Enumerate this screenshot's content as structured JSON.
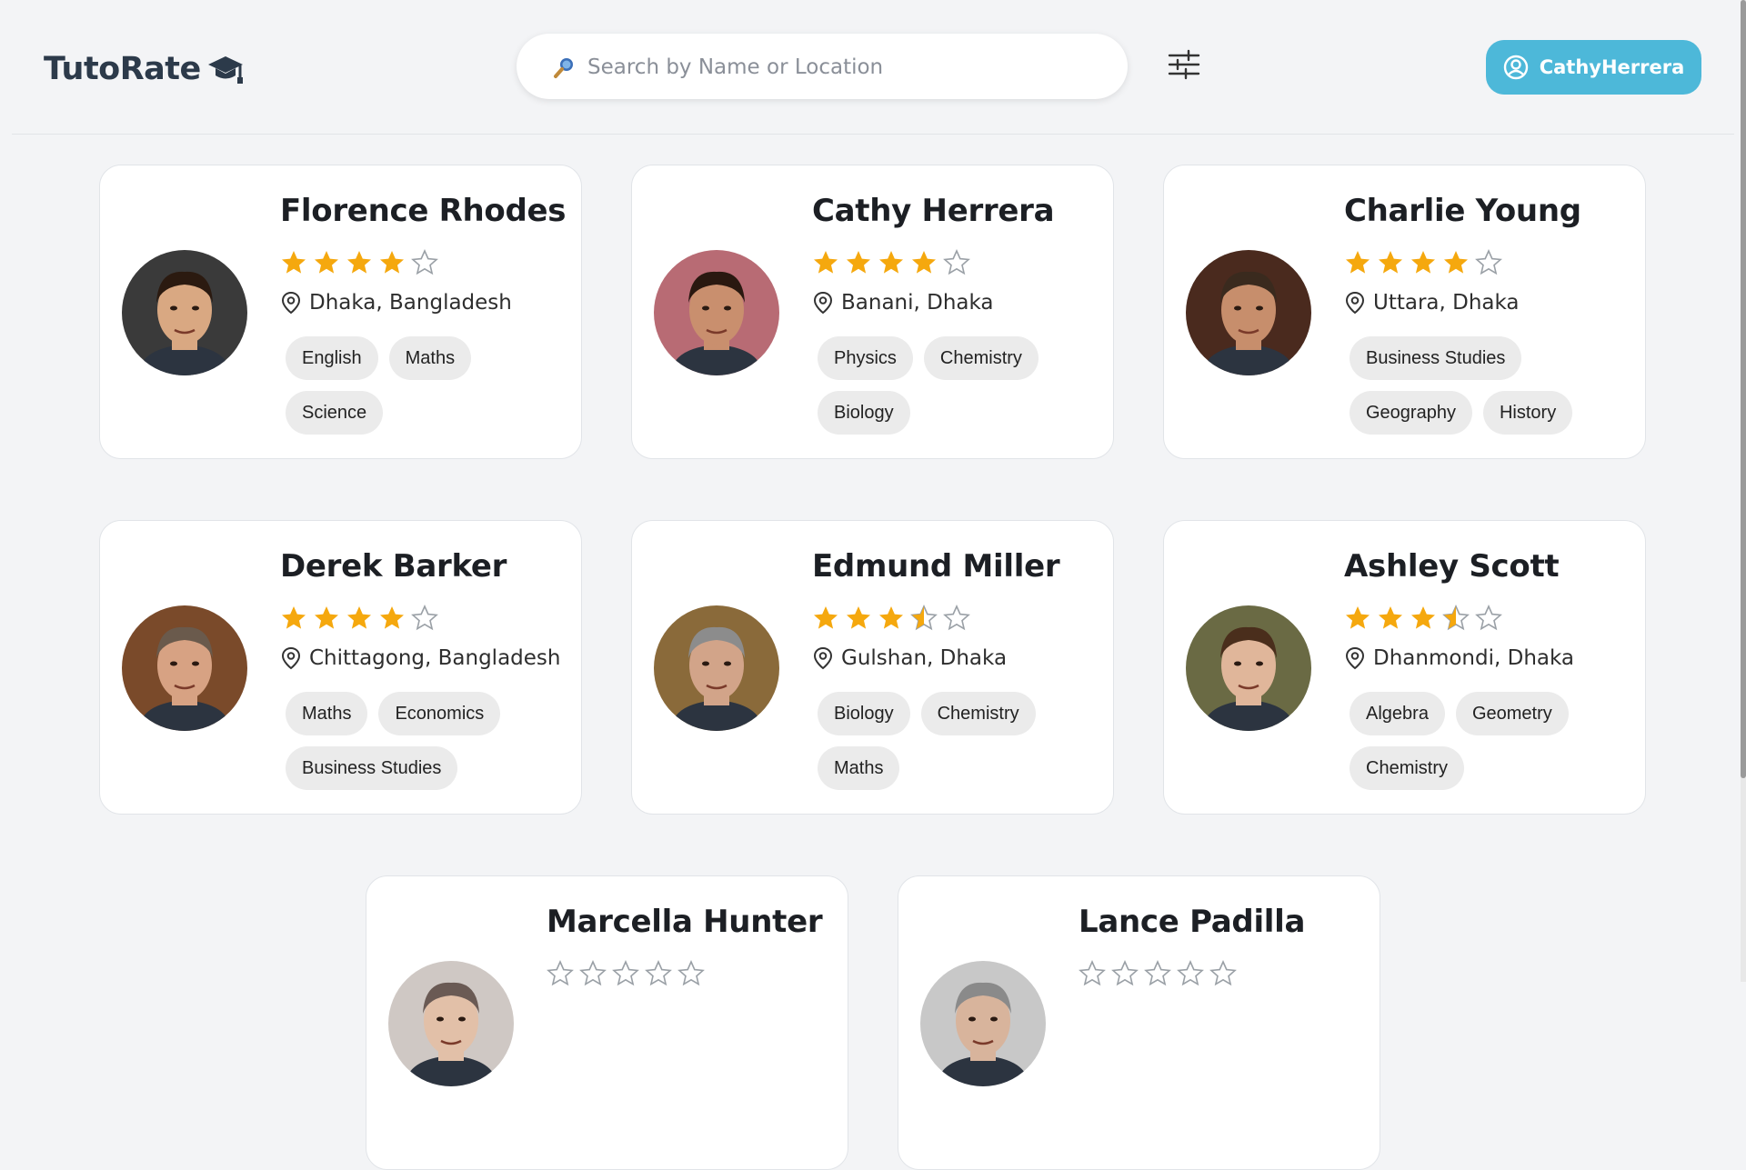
{
  "brand": {
    "name": "TutoRate"
  },
  "search": {
    "placeholder": "Search by Name or Location"
  },
  "user": {
    "name": "CathyHerrera"
  },
  "tutors": [
    {
      "name": "Florence Rhodes",
      "rating": 4,
      "location": "Dhaka, Bangladesh",
      "subjects": [
        "English",
        "Maths",
        "Science"
      ],
      "skin": "#d9a882",
      "hair": "#2b1a10",
      "bg": "#3a3a3a"
    },
    {
      "name": "Cathy Herrera",
      "rating": 4,
      "location": "Banani, Dhaka",
      "subjects": [
        "Physics",
        "Chemistry",
        "Biology"
      ],
      "skin": "#c98f6e",
      "hair": "#2a1810",
      "bg": "#b86b74"
    },
    {
      "name": "Charlie Young",
      "rating": 4,
      "location": "Uttara, Dhaka",
      "subjects": [
        "Business Studies",
        "Geography",
        "History"
      ],
      "skin": "#c78e6c",
      "hair": "#3a2a1e",
      "bg": "#4a2a1e"
    },
    {
      "name": "Derek Barker",
      "rating": 4,
      "location": "Chittagong, Bangladesh",
      "subjects": [
        "Maths",
        "Economics",
        "Business Studies"
      ],
      "skin": "#d7a283",
      "hair": "#6a5a4c",
      "bg": "#7a4a2a"
    },
    {
      "name": "Edmund Miller",
      "rating": 3.5,
      "location": "Gulshan, Dhaka",
      "subjects": [
        "Biology",
        "Chemistry",
        "Maths"
      ],
      "skin": "#d2a489",
      "hair": "#8c8c8c",
      "bg": "#8a6a3a"
    },
    {
      "name": "Ashley Scott",
      "rating": 3.5,
      "location": "Dhanmondi, Dhaka",
      "subjects": [
        "Algebra",
        "Geometry",
        "Chemistry"
      ],
      "skin": "#e0b69a",
      "hair": "#4a2e1c",
      "bg": "#6a6a44"
    },
    {
      "name": "Marcella Hunter",
      "rating": 0,
      "location": "",
      "subjects": [],
      "skin": "#e2c0a8",
      "hair": "#6a5a54",
      "bg": "#cfc8c4"
    },
    {
      "name": "Lance Padilla",
      "rating": 0,
      "location": "",
      "subjects": [],
      "skin": "#d8b49c",
      "hair": "#8a8a8a",
      "bg": "#c8c8c8"
    }
  ],
  "colors": {
    "accent": "#4db8d9",
    "star": "#f5a80e",
    "star_empty": "#9aa0a6"
  }
}
